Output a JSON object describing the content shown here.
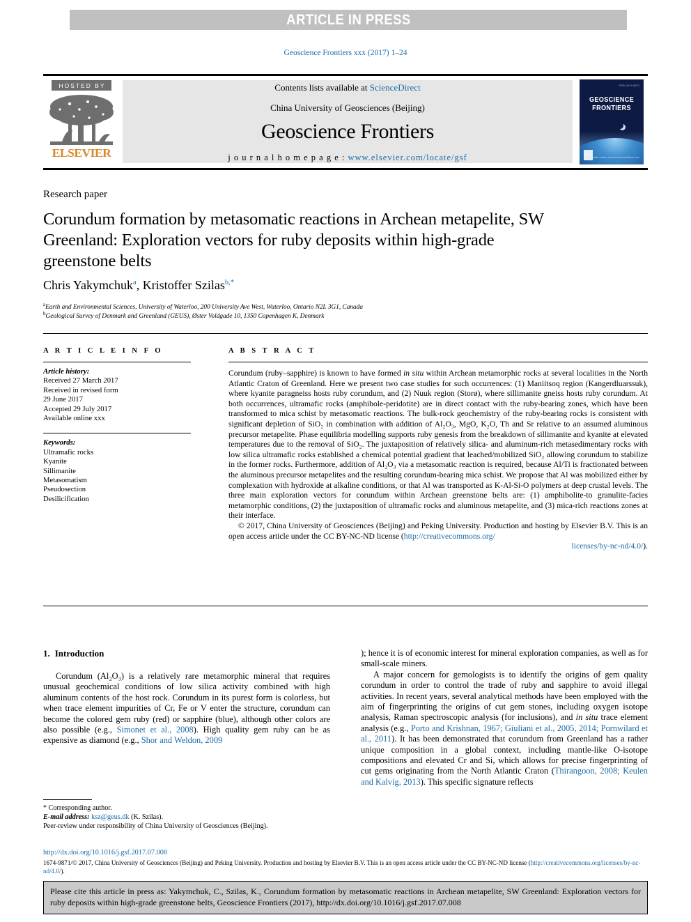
{
  "banner": {
    "text": "ARTICLE IN PRESS"
  },
  "running_head": "Geoscience Frontiers xxx (2017) 1–24",
  "masthead": {
    "hosted_by": "HOSTED BY",
    "elsevier": "ELSEVIER",
    "contents_prefix": "Contents lists available at ",
    "sciencedirect": "ScienceDirect",
    "publisher": "China University of Geosciences (Beijing)",
    "journal_name": "Geoscience Frontiers",
    "homepage_label": "j o u r n a l   h o m e p a g e :",
    "homepage_url": "www.elsevier.com/locate/gsf",
    "cover_title_line1": "GEOSCIENCE",
    "cover_title_line2": "FRONTIERS",
    "cover_topmark": "ISSN 1674-9871",
    "cover_footright": "Available online at www.sciencedirect.com"
  },
  "article": {
    "type_label": "Research paper",
    "title": "Corundum formation by metasomatic reactions in Archean metapelite, SW Greenland: Exploration vectors for ruby deposits within high-grade greenstone belts",
    "author1": "Chris Yakymchuk",
    "author1_sup": "a",
    "author_sep": ", ",
    "author2": "Kristoffer Szilas",
    "author2_sup": "b,",
    "author2_star": "*",
    "affiliation_a_sup": "a",
    "affiliation_a": "Earth and Environmental Sciences, University of Waterloo, 200 University Ave West, Waterloo, Ontario N2L 3G1, Canada",
    "affiliation_b_sup": "b",
    "affiliation_b": "Geological Survey of Denmark and Greenland (GEUS), Øster Voldgade 10, 1350 Copenhagen K, Denmark"
  },
  "article_info": {
    "heading": "A R T I C L E  I N F O",
    "history_label": "Article history:",
    "history": [
      "Received 27 March 2017",
      "Received in revised form",
      "29 June 2017",
      "Accepted 29 July 2017",
      "Available online xxx"
    ],
    "keywords_label": "Keywords:",
    "keywords": [
      "Ultramafic rocks",
      "Kyanite",
      "Sillimanite",
      "Metasomatism",
      "Pseudosection",
      "Desilicification"
    ]
  },
  "abstract": {
    "heading": "A B S T R A C T",
    "part1": "Corundum (ruby–sapphire) is known to have formed ",
    "italic1": "in situ",
    "part2": " within Archean metamorphic rocks at several localities in the North Atlantic Craton of Greenland. Here we present two case studies for such occurrences: (1) Maniitsoq region (Kangerdluarssuk), where kyanite paragneiss hosts ruby corundum, and (2) Nuuk region (Storø), where sillimanite gneiss hosts ruby corundum. At both occurrences, ultramafic rocks (amphibole-peridotite) are in direct contact with the ruby-bearing zones, which have been transformed to mica schist by metasomatic reactions. The bulk-rock geochemistry of the ruby-bearing rocks is consistent with significant depletion of SiO₂ in combination with addition of Al₂O₃, MgO, K₂O, Th and Sr relative to an assumed aluminous precursor metapelite. Phase equilibria modelling supports ruby genesis from the breakdown of sillimanite and kyanite at elevated temperatures due to the removal of SiO₂. The juxtaposition of relatively silica- and aluminum-rich metasedimentary rocks with low silica ultramafic rocks established a chemical potential gradient that leached/mobilized SiO₂ allowing corundum to stabilize in the former rocks. Furthermore, addition of Al₂O₃ via a metasomatic reaction is required, because Al/Ti is fractionated between the aluminous precursor metapelites and the resulting corundum-bearing mica schist. We propose that Al was mobilized either by complexation with hydroxide at alkaline conditions, or that Al was transported as K-Al-Si-O polymers at deep crustal levels. The three main exploration vectors for corundum within Archean greenstone belts are: (1) amphibolite-to granulite-facies metamorphic conditions, (2) the juxtaposition of ultramafic rocks and aluminous metapelite, and (3) mica-rich reactions zones at their interface.",
    "copyright": "© 2017, China University of Geosciences (Beijing) and Peking University. Production and hosting by Elsevier B.V. This is an open access article under the CC BY-NC-ND license (",
    "license_url_1": "http://creativecommons.org/",
    "license_url_2": "licenses/by-nc-nd/4.0/",
    "copyright_end": ")."
  },
  "introduction": {
    "number": "1.",
    "title": "Introduction",
    "p1_a": "Corundum (Al₂O₃) is a relatively rare metamorphic mineral that requires unusual geochemical conditions of low silica activity combined with high aluminum contents of the host rock. Corundum in its purest form is colorless, but when trace element impurities of Cr, Fe or V enter the structure, corundum can become the colored gem ruby (red) or sapphire (blue), although other colors are also possible (e.g., ",
    "p1_ref1": "Simonet et al., 2008",
    "p1_b": "). High quality gem ruby can be as expensive as diamond (e.g., ",
    "p1_ref2": "Shor and Weldon, 2009",
    "p1_c": "); hence it is of economic interest for mineral exploration companies, as well as for small-scale miners.",
    "p2_a": "A major concern for gemologists is to identify the origins of gem quality corundum in order to control the trade of ruby and sapphire to avoid illegal activities. In recent years, several analytical methods have been employed with the aim of fingerprinting the origins of cut gem stones, including oxygen isotope analysis, Raman spectroscopic analysis (for inclusions), and ",
    "p2_italic": "in situ",
    "p2_b": " trace element analysis (e.g., ",
    "p2_ref1": "Porto and Krishnan, 1967; Giuliani et al., 2005, 2014; Pornwilard et al., 2011",
    "p2_c": "). It has been demonstrated that corundum from Greenland has a rather unique composition in a global context, including mantle-like O-isotope compositions and elevated Cr and Si, which allows for precise fingerprinting of cut gems originating from the North Atlantic Craton (",
    "p2_ref2": "Thirangoon, 2008; Keulen and Kalvig, 2013",
    "p2_d": "). This specific signature reflects"
  },
  "footnotes": {
    "corresponding": "* Corresponding author.",
    "email_label": "E-mail address:",
    "email": "ksz@geus.dk",
    "email_suffix": " (K. Szilas).",
    "peer_review": "Peer-review under responsibility of China University of Geosciences (Beijing).",
    "doi": "http://dx.doi.org/10.1016/j.gsf.2017.07.008",
    "license_a": "1674-9871/© 2017, China University of Geosciences (Beijing) and Peking University. Production and hosting by Elsevier B.V. This is an open access article under the CC BY-NC-ND license (",
    "license_url": "http://creativecommons.org/licenses/by-nc-nd/4.0/",
    "license_b": ")."
  },
  "cite_box": {
    "text": "Please cite this article in press as: Yakymchuk, C., Szilas, K., Corundum formation by metasomatic reactions in Archean metapelite, SW Greenland: Exploration vectors for ruby deposits within high-grade greenstone belts, Geoscience Frontiers (2017), http://dx.doi.org/10.1016/j.gsf.2017.07.008"
  },
  "colors": {
    "link": "#1a6ba8",
    "banner_bg": "#c0c0c0",
    "masthead_bg": "#e6e6e6",
    "cite_box_bg": "#c9c9c9",
    "elsevier_orange": "#d8872a"
  }
}
